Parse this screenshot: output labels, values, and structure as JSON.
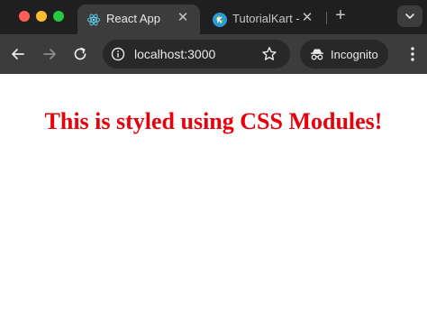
{
  "window": {
    "tabs": [
      {
        "title": "React App",
        "icon": "react-logo-icon",
        "active": true
      },
      {
        "title": "TutorialKart -",
        "icon": "tutorialkart-logo-icon",
        "active": false
      }
    ]
  },
  "toolbar": {
    "url": "localhost:3000",
    "incognito_label": "Incognito"
  },
  "page": {
    "heading": "This is styled using CSS Modules!"
  },
  "colors": {
    "heading": "#e8000b",
    "react": "#61dafb"
  }
}
